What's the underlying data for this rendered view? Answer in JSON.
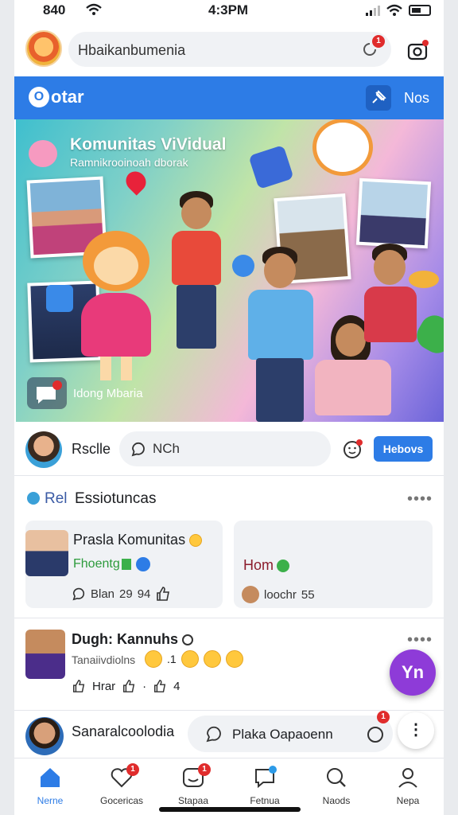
{
  "status": {
    "time_left": "840",
    "time_center": "4:3PM"
  },
  "top": {
    "search_text": "Hbaikanbumenia",
    "search_badge": "1"
  },
  "brand": {
    "logo_text": "otar",
    "logo_letter": "O",
    "right_label": "Nos"
  },
  "hero": {
    "title": "Komunitas ViVidual",
    "subtitle": "Ramnikrooinoah dborak",
    "footer_text": "Idong Mbaria"
  },
  "composer": {
    "name": "Rsclle",
    "placeholder": "NCh",
    "button_label": "Hebovs"
  },
  "section": {
    "prefix": "Rel",
    "title": "Essiotuncas",
    "more": "••••"
  },
  "cards": [
    {
      "name": "Prasla Komunitas",
      "subtitle": "Fhoentg",
      "meta_left": "Blan",
      "meta_mid": "29",
      "meta_right": "94"
    },
    {
      "name": "Hom",
      "meta_left": "loochr",
      "meta_right": "55"
    }
  ],
  "post": {
    "name": "Dugh: Kannuhs",
    "subtitle": "Tanaiivdiolns",
    "reaction_count": ".1",
    "act_left": "Hrar",
    "act_right": "4",
    "fab_text": "Yn"
  },
  "post2": {
    "name": "Sanaralcoolodia",
    "reply_placeholder": "Plaka Oapaoenn",
    "more": "⋮",
    "badge": "1"
  },
  "tabs": [
    {
      "label": "Nerne",
      "active": true,
      "badge": ""
    },
    {
      "label": "Gocericas",
      "active": false,
      "badge": "1"
    },
    {
      "label": "Stapaa",
      "active": false,
      "badge": "1"
    },
    {
      "label": "Fetnua",
      "active": false,
      "badge": ""
    },
    {
      "label": "Naods",
      "active": false,
      "badge": ""
    },
    {
      "label": "Nepa",
      "active": false,
      "badge": ""
    }
  ],
  "colors": {
    "accent": "#2d7ce6",
    "fab": "#8e3bd8",
    "badge": "#e02c2c"
  }
}
